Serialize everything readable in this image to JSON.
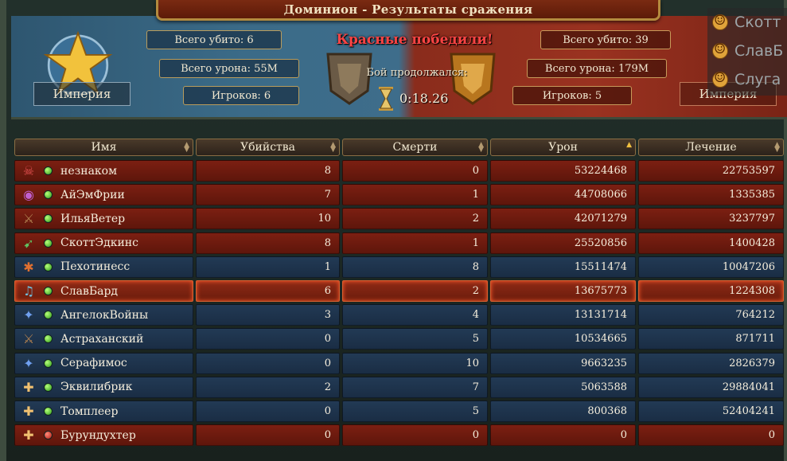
{
  "window": {
    "title": "Доминион - Результаты сражения"
  },
  "header": {
    "left": {
      "faction": "Империя",
      "killed": "Всего убито: 6",
      "damage": "Всего урона: 55M",
      "players": "Игроков: 6"
    },
    "right": {
      "faction": "Империя",
      "killed": "Всего убито: 39",
      "damage": "Всего урона: 179M",
      "players": "Игроков: 5"
    },
    "result": "Красные победили!",
    "battle_lasted": "Бой продолжался:",
    "timer": "0:18.26"
  },
  "side_list": [
    "Скотт",
    "СлавБ",
    "Слуга"
  ],
  "table": {
    "columns": [
      "Имя",
      "Убийства",
      "Смерти",
      "Урон",
      "Лечение"
    ],
    "sorted_column": "Урон",
    "rows": [
      {
        "icon": "skull-icon",
        "team": "red",
        "online": true,
        "name": "незнаком",
        "kills": "8",
        "deaths": "0",
        "damage": "53224468",
        "healing": "22753597"
      },
      {
        "icon": "eye-icon",
        "team": "red",
        "online": true,
        "name": "АйЭмФрии",
        "kills": "7",
        "deaths": "1",
        "damage": "44708066",
        "healing": "1335385"
      },
      {
        "icon": "sword-icon",
        "team": "red",
        "online": true,
        "name": "ИльяВетер",
        "kills": "10",
        "deaths": "2",
        "damage": "42071279",
        "healing": "3237797"
      },
      {
        "icon": "arrow-icon",
        "team": "red",
        "online": true,
        "name": "СкоттЭдкинс",
        "kills": "8",
        "deaths": "1",
        "damage": "25520856",
        "healing": "1400428"
      },
      {
        "icon": "paw-icon",
        "team": "blue",
        "online": true,
        "name": "Пехотинесс",
        "kills": "1",
        "deaths": "8",
        "damage": "15511474",
        "healing": "10047206"
      },
      {
        "icon": "lute-icon",
        "team": "highlight",
        "online": true,
        "name": "СлавБард",
        "kills": "6",
        "deaths": "2",
        "damage": "13675773",
        "healing": "1224308"
      },
      {
        "icon": "staff-icon",
        "team": "blue",
        "online": true,
        "name": "АнгелокВойны",
        "kills": "3",
        "deaths": "4",
        "damage": "13131714",
        "healing": "764212"
      },
      {
        "icon": "sword-icon",
        "team": "blue",
        "online": true,
        "name": "Астраханский",
        "kills": "0",
        "deaths": "5",
        "damage": "10534665",
        "healing": "871711"
      },
      {
        "icon": "staff-icon",
        "team": "blue",
        "online": true,
        "name": "Серафимос",
        "kills": "0",
        "deaths": "10",
        "damage": "9663235",
        "healing": "2826379"
      },
      {
        "icon": "cross-icon",
        "team": "blue",
        "online": true,
        "name": "Эквилибрик",
        "kills": "2",
        "deaths": "7",
        "damage": "5063588",
        "healing": "29884041"
      },
      {
        "icon": "cross-icon",
        "team": "blue",
        "online": true,
        "name": "Томплеер",
        "kills": "0",
        "deaths": "5",
        "damage": "800368",
        "healing": "52404241"
      },
      {
        "icon": "cross-icon",
        "team": "red",
        "online": false,
        "name": "Бурундухтер",
        "kills": "0",
        "deaths": "0",
        "damage": "0",
        "healing": "0"
      }
    ]
  }
}
